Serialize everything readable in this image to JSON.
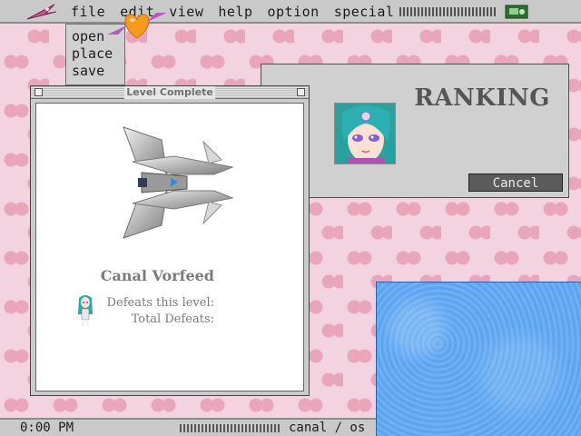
{
  "menubar": {
    "items": [
      "file",
      "edit",
      "view",
      "help",
      "option",
      "special"
    ]
  },
  "file_menu": {
    "items": [
      "open",
      "place",
      "save"
    ]
  },
  "ranking_window": {
    "title": "RANKING",
    "cancel_label": "Cancel"
  },
  "level_window": {
    "title": "Level Complete",
    "enemy_name": "Canal Vorfeed",
    "defeats_this_level_label": "Defeats this level:",
    "total_defeats_label": "Total Defeats:"
  },
  "statusbar": {
    "clock": "0:00 PM",
    "system_label": "canal / os"
  },
  "colors": {
    "background_pink": "#f3d3df",
    "heart_pink": "#e9a6bb",
    "chrome_gray": "#c9c9c9",
    "panel_blue": "#6cb0f6",
    "cancel_button": "#5b5b5b"
  },
  "icons": {
    "logo": "pink-pennant-logo-icon",
    "network": "green-network-icon",
    "cursor": "heart-cursor-icon"
  }
}
